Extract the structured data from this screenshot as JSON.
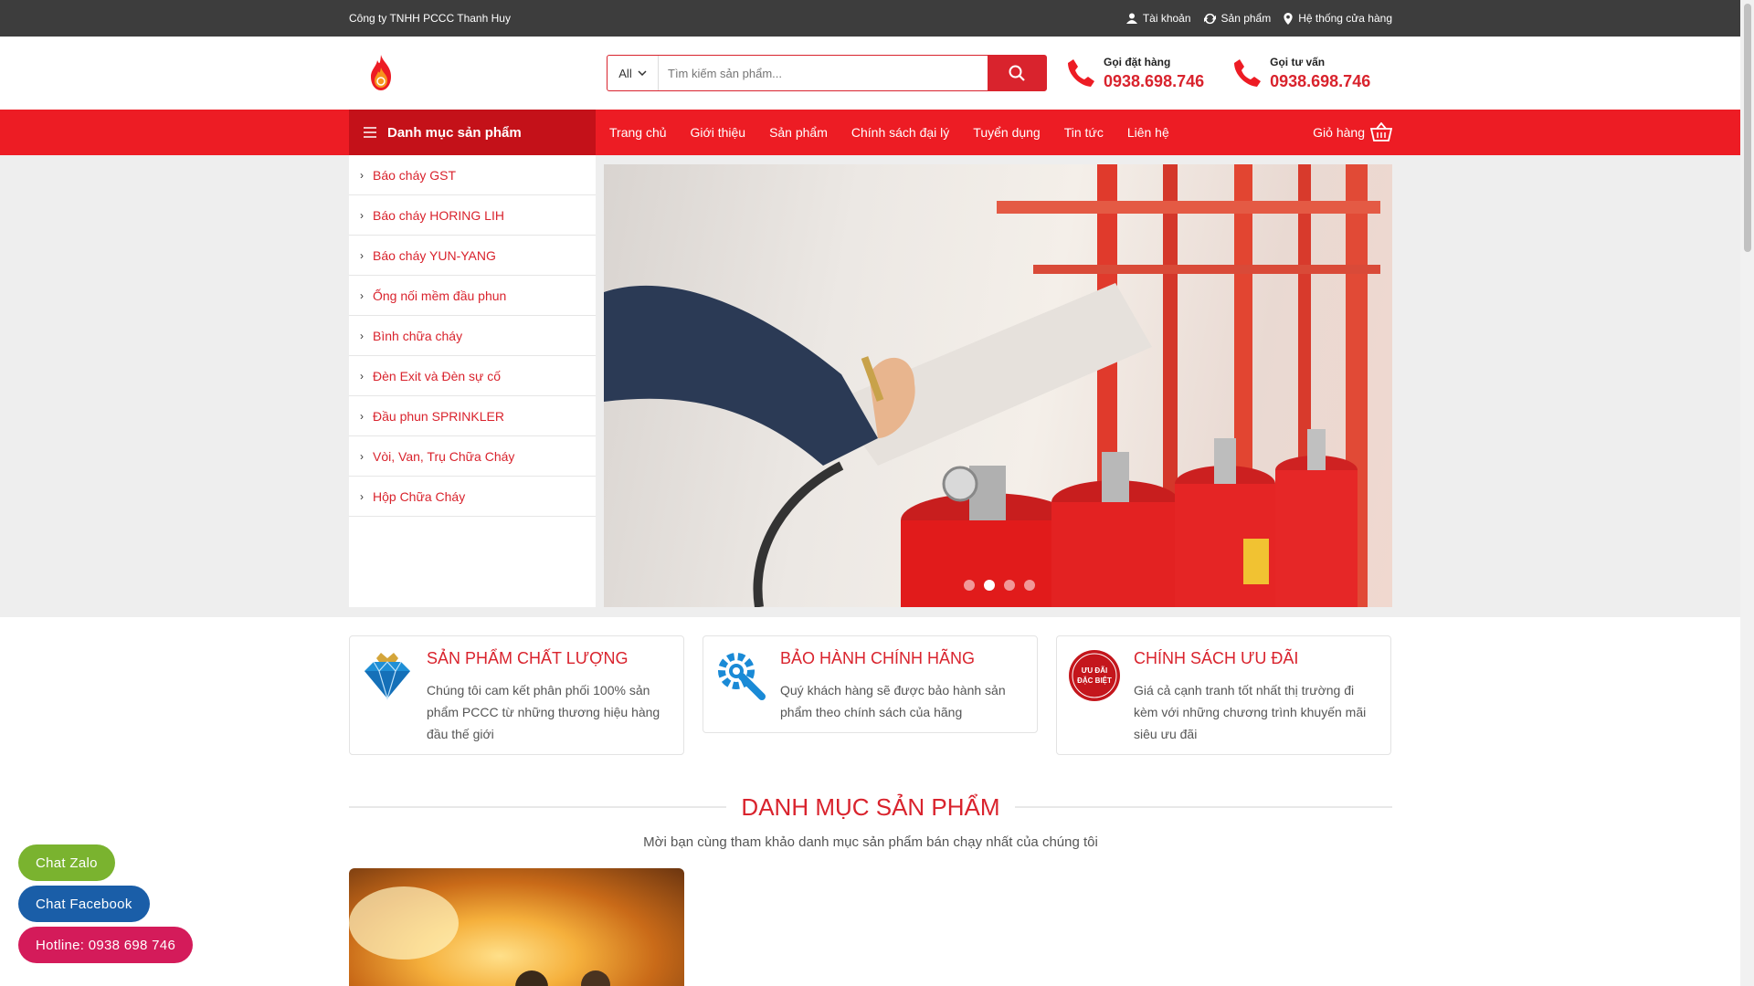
{
  "topbar": {
    "company": "Công ty TNHH PCCC Thanh Huy",
    "account": "Tài khoản",
    "products": "Sản phẩm",
    "stores": "Hệ thống cửa hàng"
  },
  "search": {
    "category": "All",
    "placeholder": "Tìm kiếm sản phẩm..."
  },
  "hotlines": [
    {
      "label": "Gọi đặt hàng",
      "number": "0938.698.746"
    },
    {
      "label": "Gọi tư vấn",
      "number": "0938.698.746"
    }
  ],
  "nav": {
    "catmenu": "Danh mục sản phẩm",
    "items": [
      "Trang chủ",
      "Giới thiệu",
      "Sản phẩm",
      "Chính sách đại lý",
      "Tuyển dụng",
      "Tin tức",
      "Liên hệ"
    ],
    "cart": "Giỏ hàng"
  },
  "sidebar": {
    "items": [
      "Báo cháy GST",
      "Báo cháy HORING LIH",
      "Báo cháy YUN-YANG",
      "Ống nối mềm đầu phun",
      "Bình chữa cháy",
      "Đèn Exit và Đèn sự cố",
      "Đầu phun SPRINKLER",
      "Vòi, Van, Trụ Chữa Cháy",
      "Hộp Chữa Cháy"
    ]
  },
  "slider": {
    "slides": 4,
    "active": 2
  },
  "features": [
    {
      "title": "SẢN PHẨM CHẤT LƯỢNG",
      "text": "Chúng tôi cam kết phân phối 100% sản phẩm PCCC từ những thương hiệu hàng đầu thế giới",
      "icon": "diamond-icon"
    },
    {
      "title": "BẢO HÀNH CHÍNH HÃNG",
      "text": "Quý khách hàng sẽ được bảo hành sản phẩm theo chính sách của hãng",
      "icon": "wrench-gear-icon"
    },
    {
      "title": "CHÍNH SÁCH ƯU ĐÃI",
      "text": "Giá cả cạnh tranh tốt nhất thị trường đi kèm với những chương trình khuyến mãi siêu ưu đãi",
      "icon": "special-offer-badge-icon",
      "badge_line1": "ƯU ĐÃI",
      "badge_line2": "ĐẶC BIỆT"
    }
  ],
  "section": {
    "title": "DANH MỤC SẢN PHẨM",
    "subtitle": "Mời bạn cùng tham khảo danh mục sản phẩm bán chạy nhất của chúng tôi"
  },
  "floating": {
    "zalo": "Chat Zalo",
    "facebook": "Chat Facebook",
    "hotline": "Hotline: 0938 698 746"
  },
  "colors": {
    "accent": "#ed1c24",
    "topbar": "#3d3d3d",
    "zalo": "#7ab32f",
    "facebook": "#1a5ea8",
    "hotline": "#d41b5a"
  }
}
